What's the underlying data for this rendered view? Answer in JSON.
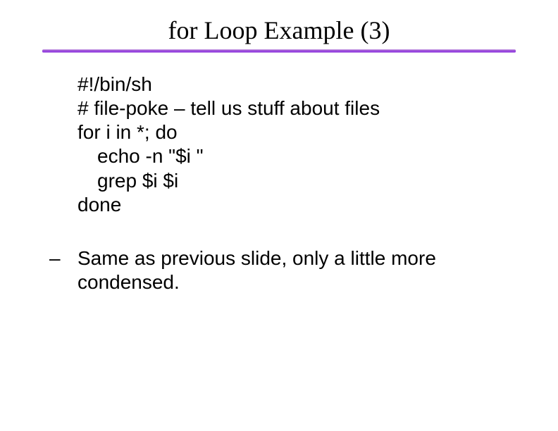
{
  "title": "for Loop Example (3)",
  "code": {
    "l1": "#!/bin/sh",
    "l2": "# file-poke – tell us stuff about files",
    "l3": "for i in *; do",
    "l4": "echo -n \"$i \"",
    "l5": "grep $i $i",
    "l6": "done"
  },
  "bullet": {
    "dash": "–",
    "text": "Same as previous slide, only a little more condensed."
  }
}
